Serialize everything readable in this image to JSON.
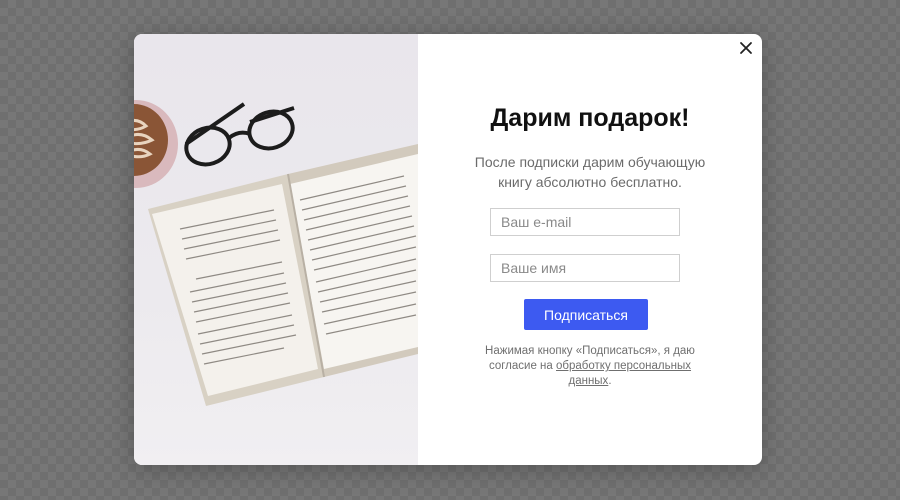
{
  "popup": {
    "close_icon": "close-icon",
    "image_icon": "open-book-with-glasses-and-coffee",
    "title": "Дарим подарок!",
    "subtitle": "После подписки дарим обучающую книгу абсолютно бесплатно.",
    "email": {
      "placeholder": "Ваш e-mail",
      "value": ""
    },
    "name": {
      "placeholder": "Ваше имя",
      "value": ""
    },
    "submit_label": "Подписаться",
    "consent_text": "Нажимая кнопку «Подписаться», я даю согласие на",
    "consent_link": "обработку персональных данных",
    "consent_end": "."
  },
  "colors": {
    "overlay": "#6f6f6f",
    "button": "#3d5af1",
    "title": "#111111",
    "text": "#6b6b6b"
  }
}
